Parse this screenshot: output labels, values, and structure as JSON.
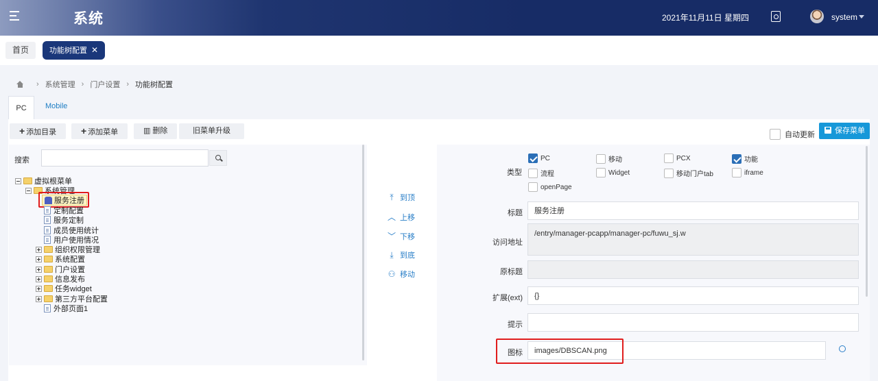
{
  "header": {
    "app_title": "系统",
    "date": "2021年11月11日 星期四",
    "user_name": "system"
  },
  "tabs": {
    "home": "首页",
    "active": "功能树配置",
    "close": "✕"
  },
  "breadcrumb": [
    "系统管理",
    "门户设置",
    "功能树配置"
  ],
  "platform_tabs": [
    "PC",
    "Mobile"
  ],
  "toolbar": {
    "add_dir": "添加目录",
    "add_menu": "添加菜单",
    "delete": "删除",
    "upgrade": "旧菜单升级",
    "auto_update": "自动更新",
    "save": "保存菜单"
  },
  "search": {
    "label": "搜索",
    "value": ""
  },
  "tree": {
    "root": "虚拟根菜单",
    "system_mgmt": "系统管理",
    "children": [
      "服务注册",
      "定制配置",
      "服务定制",
      "成员使用统计",
      "用户使用情况"
    ],
    "groups": [
      "组织权限管理",
      "系统配置",
      "门户设置",
      "信息发布",
      "任务widget",
      "第三方平台配置"
    ],
    "last": "外部页面1"
  },
  "move_actions": [
    "到顶",
    "上移",
    "下移",
    "到底",
    "移动"
  ],
  "form": {
    "type_label": "类型",
    "types": [
      {
        "label": "PC",
        "checked": true
      },
      {
        "label": "移动",
        "checked": false
      },
      {
        "label": "PCX",
        "checked": false
      },
      {
        "label": "功能",
        "checked": true
      },
      {
        "label": "流程",
        "checked": false
      },
      {
        "label": "Widget",
        "checked": false
      },
      {
        "label": "移动门户tab",
        "checked": false
      },
      {
        "label": "iframe",
        "checked": false
      },
      {
        "label": "openPage",
        "checked": false
      }
    ],
    "title_label": "标题",
    "title_value": "服务注册",
    "url_label": "访问地址",
    "url_value": "/entry/manager-pcapp/manager-pc/fuwu_sj.w",
    "orig_title_label": "原标题",
    "orig_title_value": "",
    "ext_label": "扩展(ext)",
    "ext_value": "{}",
    "hint_label": "提示",
    "hint_value": "",
    "icon_label": "图标",
    "icon_value": "images/DBSCAN.png"
  }
}
